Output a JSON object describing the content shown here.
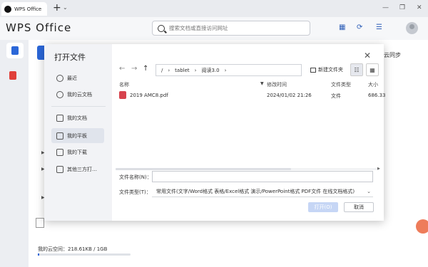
{
  "tab": {
    "title": "WPS Office"
  },
  "header": {
    "brand": "WPS Office",
    "search_placeholder": "搜索文档或直接访问网址"
  },
  "background": {
    "cloud_sync": "云同步",
    "cloud_space": "我的云空间：218.61KB / 1GB",
    "cloud_space_used_fraction": 0.0002
  },
  "dialog": {
    "title": "打开文件",
    "sidebar": [
      {
        "label": "最近",
        "icon": "clock-icon"
      },
      {
        "label": "我的云文档",
        "icon": "cloud-doc-icon"
      },
      {
        "label": "我的文档",
        "icon": "folder-icon"
      },
      {
        "label": "我的平板",
        "icon": "tablet-icon",
        "active": true
      },
      {
        "label": "我的下载",
        "icon": "download-icon"
      },
      {
        "label": "其他三方打…",
        "icon": "apps-icon"
      }
    ],
    "path": [
      "/",
      "tablet",
      "阅读3.0"
    ],
    "new_folder": "新建文件夹",
    "columns": {
      "name": "名称",
      "modified": "修改时间",
      "type": "文件类型",
      "size": "大小"
    },
    "files": [
      {
        "name": "2019 AMC8.pdf",
        "modified": "2024/01/02 21:26",
        "type": "文件",
        "size": "686.33"
      }
    ],
    "filename_label": "文件名称(N)：",
    "filename_value": "",
    "filetype_label": "文件类型(T)：",
    "filetype_value": "常用文件(文字/Word格式 表格/Excel格式 演示/PowerPoint格式 PDF文件 在线文档格式)",
    "open_button": "打开(O)",
    "cancel_button": "取消"
  }
}
